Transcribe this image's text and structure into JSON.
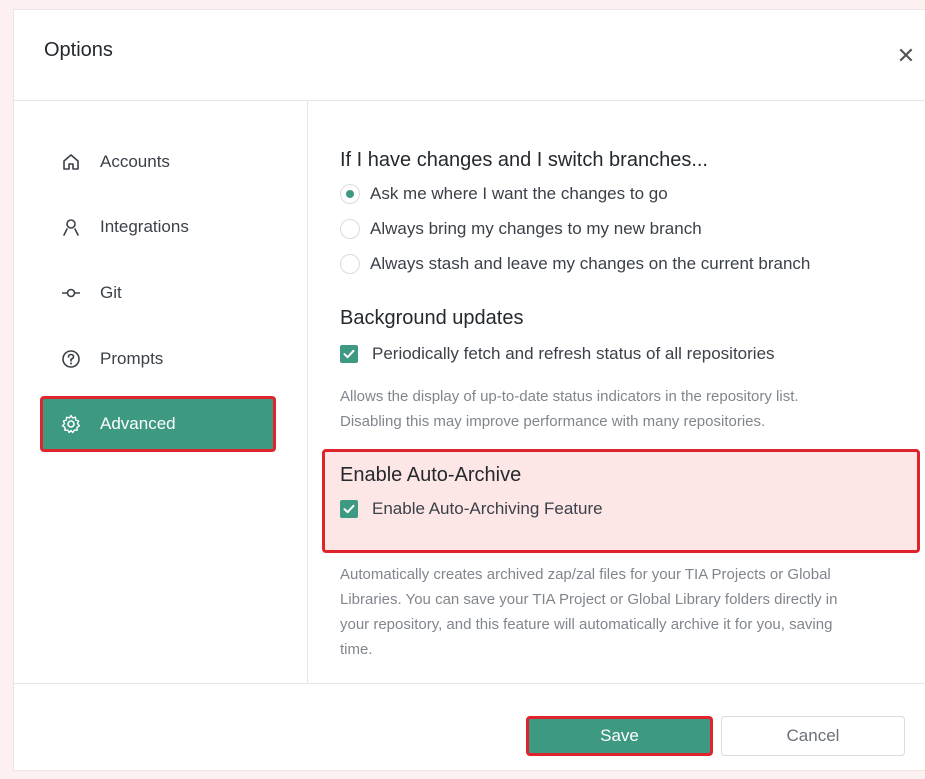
{
  "dialog": {
    "title": "Options",
    "close_icon": "close-icon"
  },
  "sidebar": {
    "items": [
      {
        "label": "Accounts",
        "icon": "home-icon"
      },
      {
        "label": "Integrations",
        "icon": "person-icon"
      },
      {
        "label": "Git",
        "icon": "git-commit-icon"
      },
      {
        "label": "Prompts",
        "icon": "question-icon"
      },
      {
        "label": "Advanced",
        "icon": "gear-icon",
        "active": true
      }
    ]
  },
  "branch_switch": {
    "heading": "If I have changes and I switch branches...",
    "options": [
      {
        "label": "Ask me where I want the changes to go",
        "selected": true
      },
      {
        "label": "Always bring my changes to my new branch",
        "selected": false
      },
      {
        "label": "Always stash and leave my changes on the current branch",
        "selected": false
      }
    ]
  },
  "background_updates": {
    "heading": "Background updates",
    "checkbox_label": "Periodically fetch and refresh status of all repositories",
    "checked": true,
    "description_line1": "Allows the display of up-to-date status indicators in the repository list.",
    "description_line2": "Disabling this may improve performance with many repositories."
  },
  "auto_archive": {
    "heading": "Enable Auto-Archive",
    "checkbox_label": "Enable Auto-Archiving Feature",
    "checked": true,
    "description_line1": "Automatically creates archived zap/zal files for your TIA Projects or Global",
    "description_line2": "Libraries. You can save your TIA Project or Global Library folders directly in",
    "description_line3": "your repository, and this feature will automatically archive it for you, saving",
    "description_line4": "time."
  },
  "footer": {
    "save_label": "Save",
    "cancel_label": "Cancel"
  },
  "colors": {
    "accent": "#3e9983",
    "highlight_border": "#e0242b",
    "highlight_fill": "#fde6e6"
  }
}
